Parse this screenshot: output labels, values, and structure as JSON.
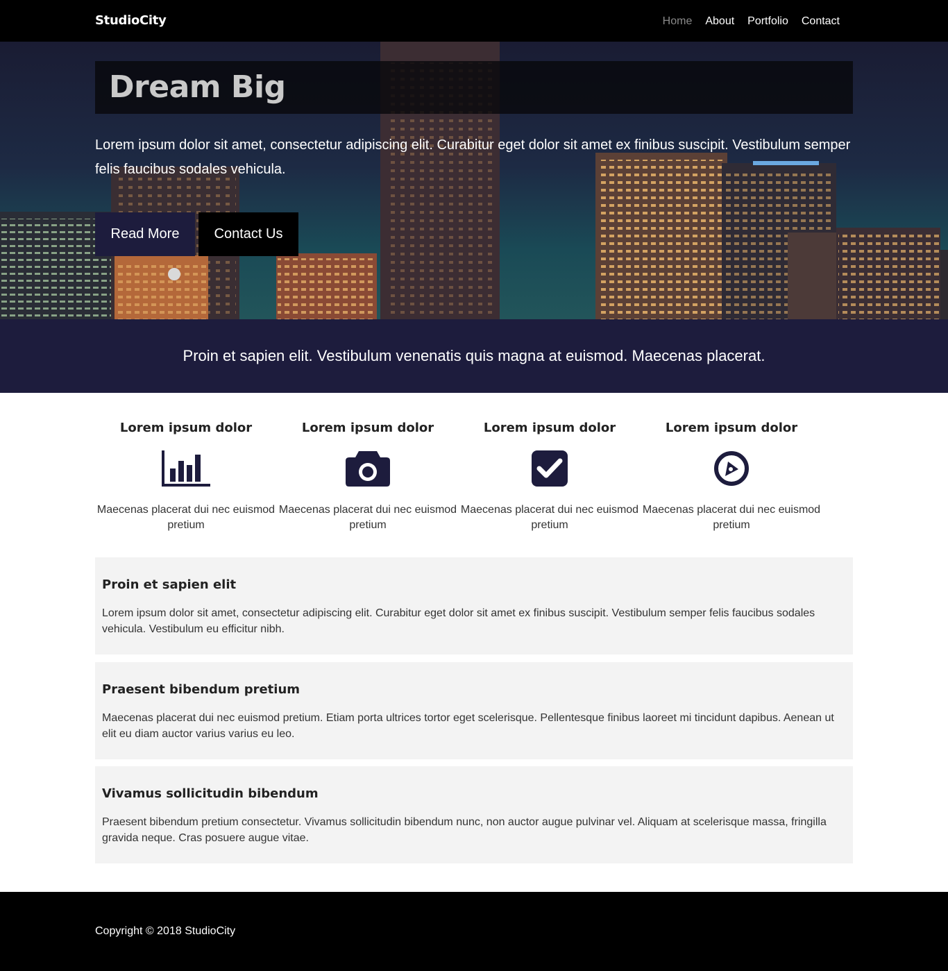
{
  "nav": {
    "brand": "StudioCity",
    "links": [
      {
        "label": "Home",
        "active": true
      },
      {
        "label": "About",
        "active": false
      },
      {
        "label": "Portfolio",
        "active": false
      },
      {
        "label": "Contact",
        "active": false
      }
    ]
  },
  "hero": {
    "title": "Dream Big",
    "text": "Lorem ipsum dolor sit amet, consectetur adipiscing elit. Curabitur eget dolor sit amet ex finibus suscipit. Vestibulum semper felis faucibus sodales vehicula.",
    "primary_button": "Read More",
    "secondary_button": "Contact Us"
  },
  "banner": {
    "text": "Proin et sapien elit. Vestibulum venenatis quis magna at euismod. Maecenas placerat."
  },
  "features": [
    {
      "title": "Lorem ipsum dolor",
      "icon": "bar-chart-icon",
      "text": "Maecenas placerat dui nec euismod pretium"
    },
    {
      "title": "Lorem ipsum dolor",
      "icon": "camera-icon",
      "text": "Maecenas placerat dui nec euismod pretium"
    },
    {
      "title": "Lorem ipsum dolor",
      "icon": "check-square-icon",
      "text": "Maecenas placerat dui nec euismod pretium"
    },
    {
      "title": "Lorem ipsum dolor",
      "icon": "compass-icon",
      "text": "Maecenas placerat dui nec euismod pretium"
    }
  ],
  "boxes": [
    {
      "title": "Proin et sapien elit",
      "text": "Lorem ipsum dolor sit amet, consectetur adipiscing elit. Curabitur eget dolor sit amet ex finibus suscipit. Vestibulum semper felis faucibus sodales vehicula. Vestibulum eu efficitur nibh."
    },
    {
      "title": "Praesent bibendum pretium",
      "text": "Maecenas placerat dui nec euismod pretium. Etiam porta ultrices tortor eget scelerisque. Pellentesque finibus laoreet mi tincidunt dapibus. Aenean ut elit eu diam auctor varius varius eu leo."
    },
    {
      "title": "Vivamus sollicitudin bibendum",
      "text": "Praesent bibendum pretium consectetur. Vivamus sollicitudin bibendum nunc, non auctor augue pulvinar vel. Aliquam at scelerisque massa, fringilla gravida neque. Cras posuere augue vitae."
    }
  ],
  "footer": {
    "copyright": "Copyright © 2018 StudioCity"
  },
  "colors": {
    "navbar": "#000000",
    "accent": "#1d1c3d",
    "box_background": "#f3f3f3",
    "nav_active": "#8a8a8a"
  }
}
